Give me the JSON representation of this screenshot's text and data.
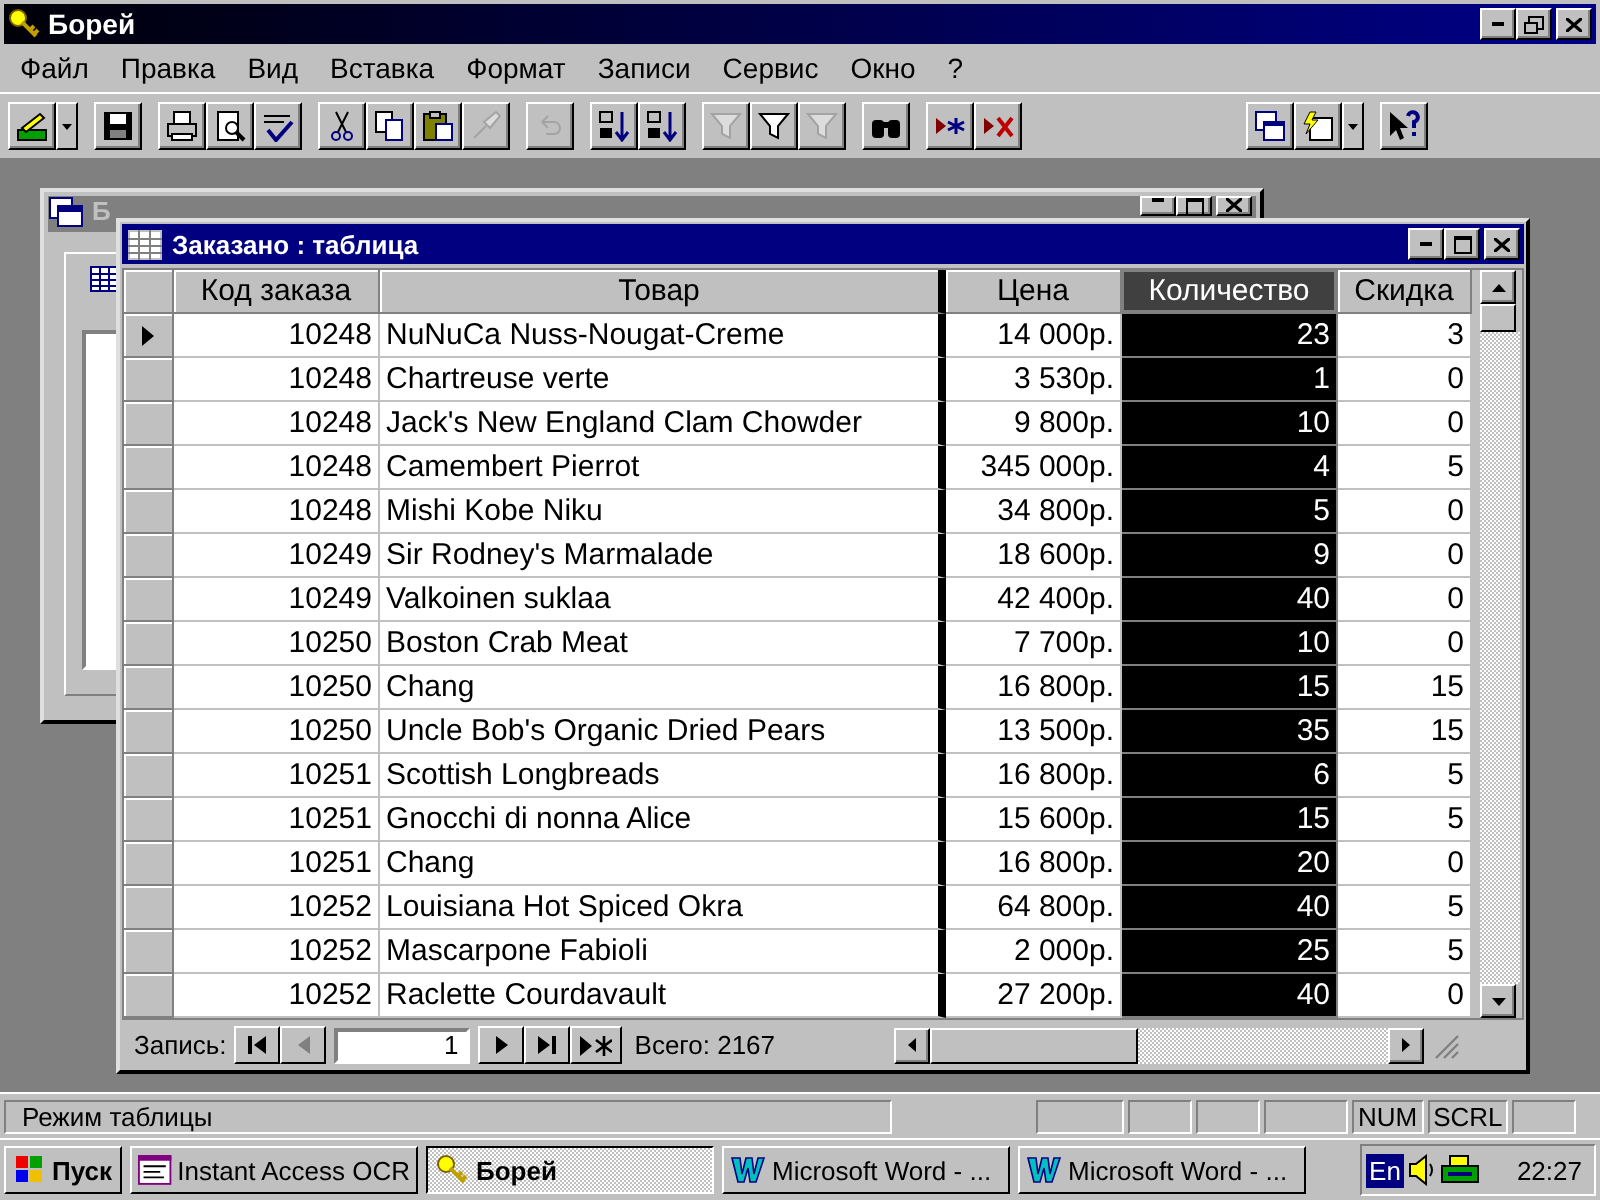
{
  "app_window": {
    "title": "Борей"
  },
  "menu": [
    "Файл",
    "Правка",
    "Вид",
    "Вставка",
    "Формат",
    "Записи",
    "Сервис",
    "Окно",
    "?"
  ],
  "toolbar": [
    {
      "kind": "view",
      "disabled": false,
      "dropdown": true
    },
    {
      "kind": "separator"
    },
    {
      "kind": "save",
      "disabled": false
    },
    {
      "kind": "separator"
    },
    {
      "kind": "print",
      "disabled": false
    },
    {
      "kind": "preview",
      "disabled": false
    },
    {
      "kind": "spelling",
      "disabled": false
    },
    {
      "kind": "separator"
    },
    {
      "kind": "cut",
      "disabled": false
    },
    {
      "kind": "copy",
      "disabled": false
    },
    {
      "kind": "paste",
      "disabled": false
    },
    {
      "kind": "brush",
      "disabled": true
    },
    {
      "kind": "separator"
    },
    {
      "kind": "undo",
      "disabled": true
    },
    {
      "kind": "separator"
    },
    {
      "kind": "sort_asc",
      "disabled": false
    },
    {
      "kind": "sort_desc",
      "disabled": false
    },
    {
      "kind": "separator"
    },
    {
      "kind": "filter_selection",
      "disabled": true
    },
    {
      "kind": "filter_form",
      "disabled": false
    },
    {
      "kind": "apply_filter",
      "disabled": true
    },
    {
      "kind": "separator"
    },
    {
      "kind": "find",
      "disabled": false
    },
    {
      "kind": "separator"
    },
    {
      "kind": "new_record",
      "disabled": false
    },
    {
      "kind": "delete_record",
      "disabled": false
    },
    {
      "kind": "spacer"
    },
    {
      "kind": "db_window",
      "disabled": false
    },
    {
      "kind": "new_object",
      "disabled": false,
      "dropdown": true
    },
    {
      "kind": "separator"
    },
    {
      "kind": "help",
      "disabled": false
    }
  ],
  "back_window": {
    "title": "Б"
  },
  "table_window": {
    "title": "Заказано : таблица",
    "columns": [
      {
        "label": "Код заказа",
        "kind": "number",
        "selected": false
      },
      {
        "label": "Товар",
        "kind": "text",
        "selected": false
      },
      {
        "label": "Цена",
        "kind": "number",
        "selected": false
      },
      {
        "label": "Количество",
        "kind": "number",
        "selected": true
      },
      {
        "label": "Скидка",
        "kind": "number",
        "selected": false
      }
    ],
    "rows": [
      {
        "current": true,
        "cells": [
          "10248",
          "NuNuCa Nuss-Nougat-Creme",
          "14 000р.",
          "23",
          "3"
        ]
      },
      {
        "current": false,
        "cells": [
          "10248",
          "Chartreuse verte",
          "3 530р.",
          "1",
          "0"
        ]
      },
      {
        "current": false,
        "cells": [
          "10248",
          "Jack's New England Clam Chowder",
          "9 800р.",
          "10",
          "0"
        ]
      },
      {
        "current": false,
        "cells": [
          "10248",
          "Camembert Pierrot",
          "345 000р.",
          "4",
          "5"
        ]
      },
      {
        "current": false,
        "cells": [
          "10248",
          "Mishi Kobe Niku",
          "34 800р.",
          "5",
          "0"
        ]
      },
      {
        "current": false,
        "cells": [
          "10249",
          "Sir Rodney's Marmalade",
          "18 600р.",
          "9",
          "0"
        ]
      },
      {
        "current": false,
        "cells": [
          "10249",
          "Valkoinen suklaa",
          "42 400р.",
          "40",
          "0"
        ]
      },
      {
        "current": false,
        "cells": [
          "10250",
          "Boston Crab Meat",
          "7 700р.",
          "10",
          "0"
        ]
      },
      {
        "current": false,
        "cells": [
          "10250",
          "Chang",
          "16 800р.",
          "15",
          "15"
        ]
      },
      {
        "current": false,
        "cells": [
          "10250",
          "Uncle Bob's Organic Dried Pears",
          "13 500р.",
          "35",
          "15"
        ]
      },
      {
        "current": false,
        "cells": [
          "10251",
          "Scottish Longbreads",
          "16 800р.",
          "6",
          "5"
        ]
      },
      {
        "current": false,
        "cells": [
          "10251",
          "Gnocchi di nonna Alice",
          "15 600р.",
          "15",
          "5"
        ]
      },
      {
        "current": false,
        "cells": [
          "10251",
          "Chang",
          "16 800р.",
          "20",
          "0"
        ]
      },
      {
        "current": false,
        "cells": [
          "10252",
          "Louisiana Hot Spiced Okra",
          "64 800р.",
          "40",
          "5"
        ]
      },
      {
        "current": false,
        "cells": [
          "10252",
          "Mascarpone Fabioli",
          "2 000р.",
          "25",
          "5"
        ]
      },
      {
        "current": false,
        "cells": [
          "10252",
          "Raclette Courdavault",
          "27 200р.",
          "40",
          "0"
        ]
      }
    ],
    "navigation": {
      "label": "Запись:",
      "record": "1",
      "total": "Всего: 2167"
    }
  },
  "status_bar": {
    "text": "Режим таблицы",
    "indicators": [
      "NUM",
      "SCRL"
    ]
  },
  "taskbar": {
    "start": "Пуск",
    "tasks": [
      {
        "label": "Instant Access OCR",
        "kind": "ocr",
        "selected": false
      },
      {
        "label": "Борей",
        "kind": "key",
        "selected": true
      },
      {
        "label": "Microsoft Word - ...",
        "kind": "word",
        "selected": false
      },
      {
        "label": "Microsoft Word - ...",
        "kind": "word",
        "selected": false
      }
    ],
    "language": "En",
    "clock": "22:27"
  }
}
